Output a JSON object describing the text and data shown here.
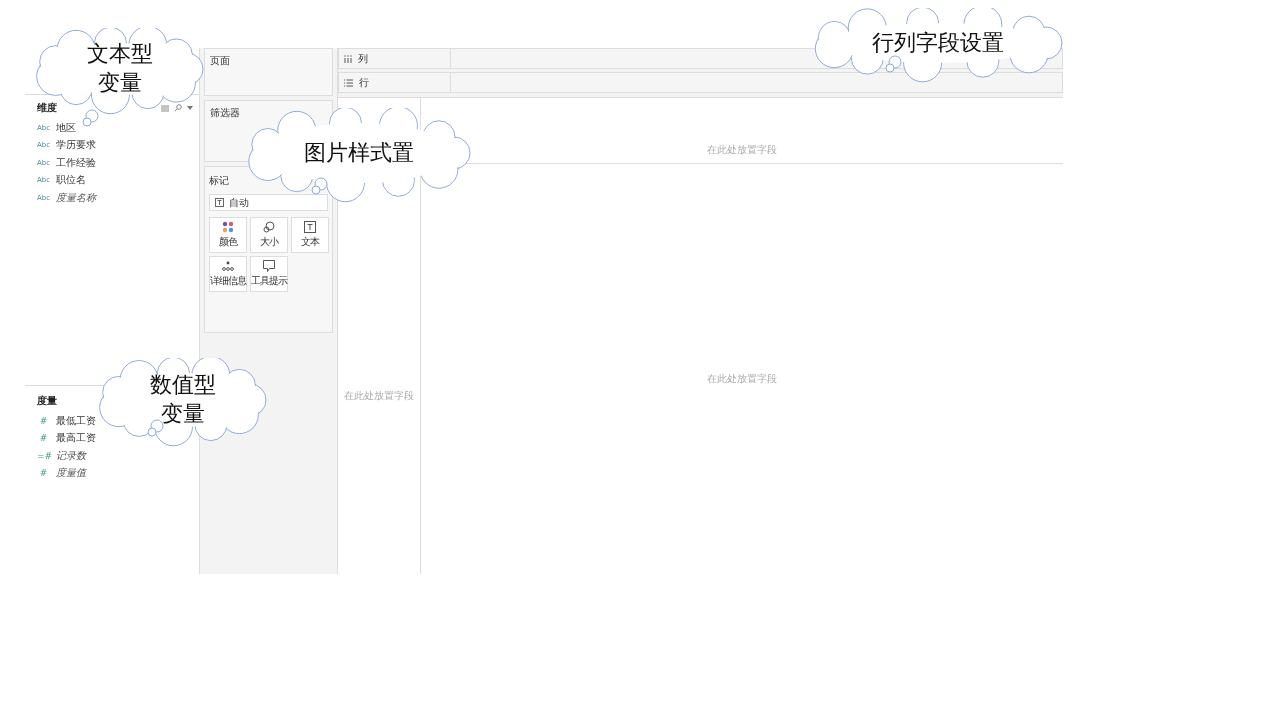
{
  "data_pane": {
    "dimensions": {
      "title": "维度",
      "fields": [
        {
          "type_icon": "Abc",
          "name": "地区",
          "italic": false
        },
        {
          "type_icon": "Abc",
          "name": "学历要求",
          "italic": false
        },
        {
          "type_icon": "Abc",
          "name": "工作经验",
          "italic": false
        },
        {
          "type_icon": "Abc",
          "name": "职位名",
          "italic": false
        },
        {
          "type_icon": "Abc",
          "name": "度量名称",
          "italic": true
        }
      ]
    },
    "measures": {
      "title": "度量",
      "fields": [
        {
          "type_icon": "#",
          "name": "最低工资",
          "italic": false
        },
        {
          "type_icon": "#",
          "name": "最高工资",
          "italic": false
        },
        {
          "type_icon": "=#",
          "name": "记录数",
          "italic": true
        },
        {
          "type_icon": "#",
          "name": "度量值",
          "italic": true
        }
      ]
    }
  },
  "cards": {
    "pages": "页面",
    "filters": "筛选器",
    "marks": {
      "title": "标记",
      "mark_type": "自动",
      "buttons": [
        {
          "kind": "color",
          "label": "颜色"
        },
        {
          "kind": "size",
          "label": "大小"
        },
        {
          "kind": "text",
          "label": "文本"
        },
        {
          "kind": "detail",
          "label": "详细信息"
        },
        {
          "kind": "tooltip",
          "label": "工具提示"
        }
      ]
    }
  },
  "shelves": [
    {
      "kind": "columns",
      "label": "列"
    },
    {
      "kind": "rows",
      "label": "行"
    }
  ],
  "view": {
    "rows_hint": "在此处放置字段",
    "columns_hint": "在此处放置字段",
    "main_hint": "在此处放置字段"
  },
  "callouts": [
    {
      "lines": [
        "文本型",
        "变量"
      ]
    },
    {
      "lines": [
        "图片样式置"
      ]
    },
    {
      "lines": [
        "数值型",
        "变量"
      ]
    },
    {
      "lines": [
        "行列字段设置"
      ]
    }
  ]
}
